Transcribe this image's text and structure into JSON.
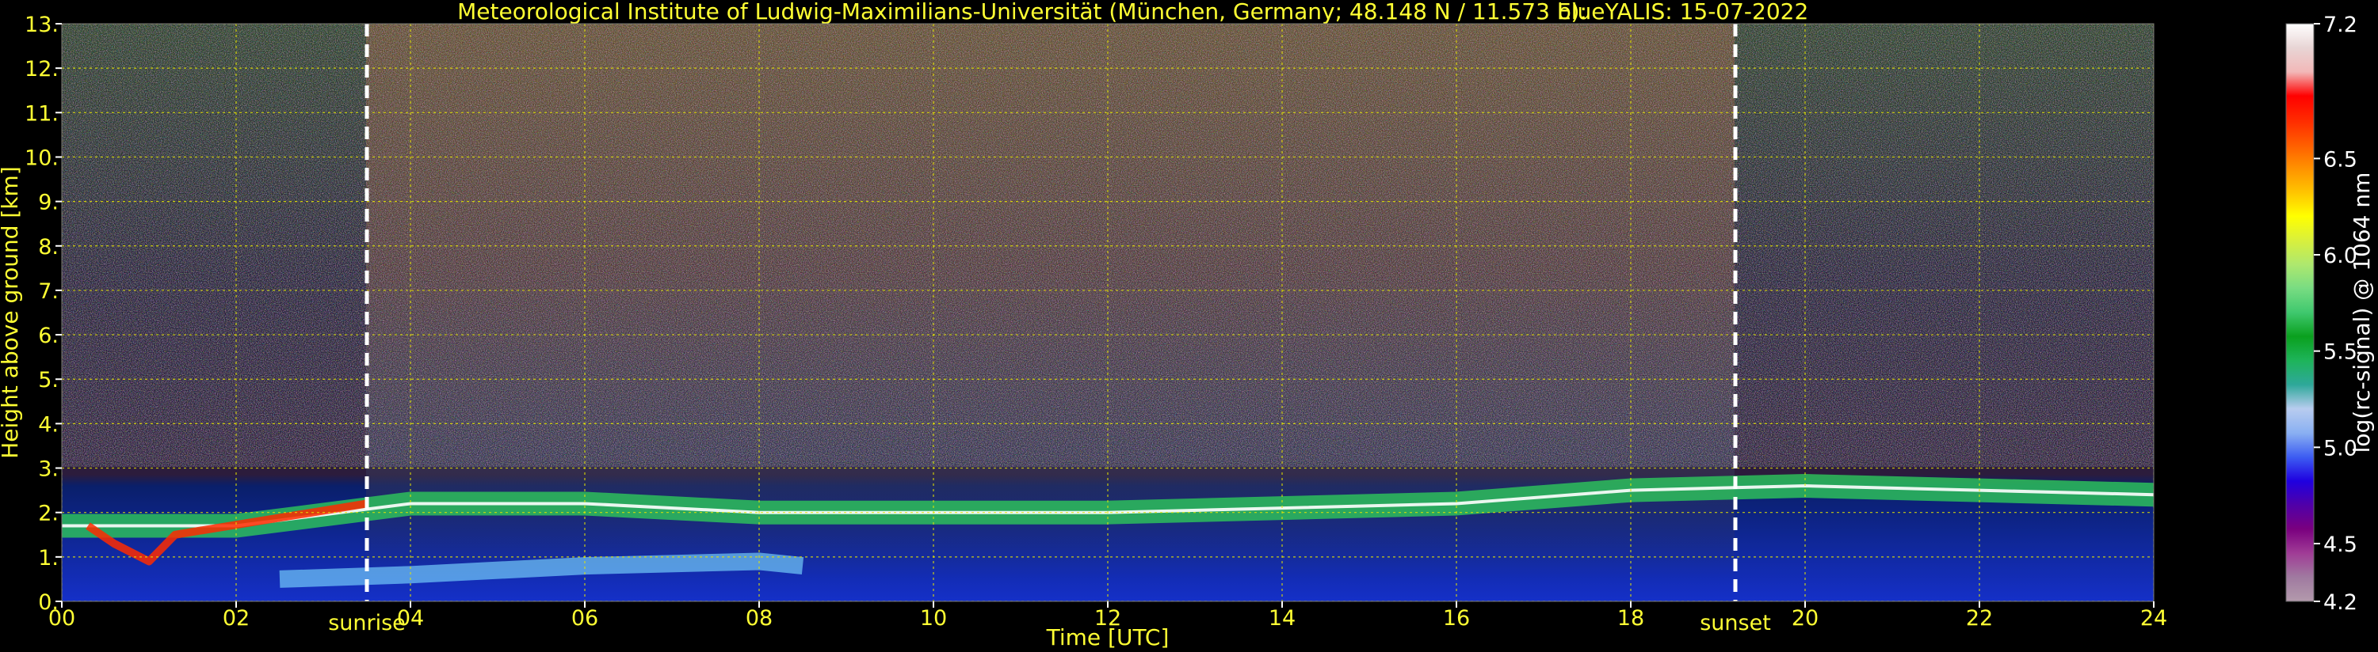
{
  "chart_data": {
    "type": "heatmap",
    "title": "Meteorological Institute of Ludwig-Maximilians-Universität (München, Germany; 48.148 N / 11.573 E):",
    "subtitle": "blueYALIS: 15-07-2022",
    "xlabel": "Time [UTC]",
    "ylabel": "Height above ground [km]",
    "xlim": [
      0,
      24
    ],
    "ylim": [
      0,
      13
    ],
    "x_ticks": [
      "00",
      "02",
      "04",
      "06",
      "08",
      "10",
      "12",
      "14",
      "16",
      "18",
      "20",
      "22",
      "24"
    ],
    "y_ticks": [
      "0.",
      "1.",
      "2.",
      "3.",
      "4.",
      "5.",
      "6.",
      "7.",
      "8.",
      "9.",
      "10.",
      "11.",
      "12.",
      "13."
    ],
    "grid": true,
    "annotations": [
      {
        "label": "sunrise",
        "x": 3.5
      },
      {
        "label": "sunset",
        "x": 19.2
      }
    ],
    "colorbar": {
      "label": "log(rc-signal) @ 1064 nm",
      "range": [
        4.2,
        7.2
      ],
      "ticks": [
        "4.2",
        "4.5",
        "5.0",
        "5.5",
        "6.0",
        "6.5",
        "7.2"
      ],
      "tick_values": [
        4.2,
        4.5,
        5.0,
        5.5,
        6.0,
        6.5,
        7.2
      ],
      "colors": [
        "#b39aac",
        "#a07aa0",
        "#a03c96",
        "#7a007f",
        "#5000a8",
        "#1f00e0",
        "#3d5df2",
        "#8ab0f2",
        "#b8ccef",
        "#2ea89a",
        "#1eb45a",
        "#0aa01e",
        "#3fc86e",
        "#78dc82",
        "#aee86e",
        "#d9f03c",
        "#ffff00",
        "#ffc400",
        "#ff9100",
        "#ff5c00",
        "#ff2a00",
        "#ff0000",
        "#f2b8b8",
        "#e8d5d5",
        "#ffffff"
      ]
    },
    "features": [
      {
        "name": "boundary layer aerosol top (km)",
        "x": [
          0,
          2,
          4,
          6,
          8,
          10,
          12,
          14,
          16,
          18,
          20,
          22,
          24
        ],
        "y": [
          1.7,
          1.7,
          2.2,
          2.2,
          2.0,
          2.0,
          2.0,
          2.1,
          2.2,
          2.5,
          2.6,
          2.5,
          2.4
        ]
      },
      {
        "name": "residual layer (km)",
        "x": [
          2.5,
          4,
          6,
          8,
          8.5
        ],
        "y": [
          0.5,
          0.6,
          0.8,
          0.9,
          0.8
        ]
      },
      {
        "name": "low cloud bases (km)",
        "x": [
          0.3,
          0.6,
          1.0,
          1.3,
          3.5
        ],
        "y": [
          1.7,
          1.3,
          0.9,
          1.5,
          2.2
        ]
      }
    ]
  }
}
